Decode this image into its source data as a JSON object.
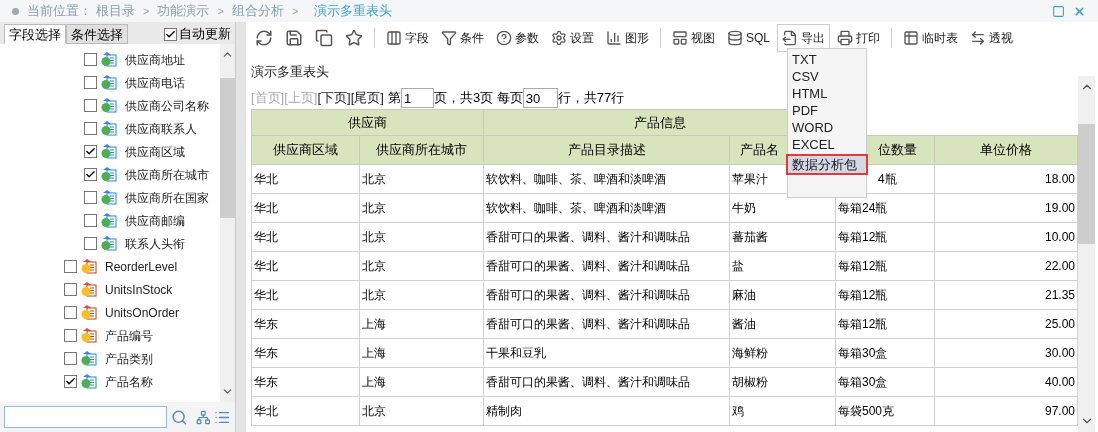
{
  "breadcrumb": {
    "label": "当前位置：",
    "items": [
      {
        "text": "根目录",
        "current": false
      },
      {
        "text": "功能演示",
        "current": false
      },
      {
        "text": "组合分析",
        "current": false
      },
      {
        "text": "演示多重表头",
        "current": true
      }
    ],
    "separator": ">"
  },
  "left_tabs": [
    {
      "label": "字段选择",
      "selected": true
    },
    {
      "label": "条件选择",
      "selected": false
    }
  ],
  "auto_update": {
    "label": "自动更新",
    "checked": true
  },
  "tree": [
    {
      "children": [
        {
          "label": "供应商地址",
          "checked": false,
          "kind": "dimension"
        },
        {
          "label": "供应商电话",
          "checked": false,
          "kind": "dimension"
        },
        {
          "label": "供应商公司名称",
          "checked": false,
          "kind": "dimension"
        },
        {
          "label": "供应商联系人",
          "checked": false,
          "kind": "dimension"
        },
        {
          "label": "供应商区域",
          "checked": true,
          "kind": "dimension"
        },
        {
          "label": "供应商所在城市",
          "checked": true,
          "kind": "dimension"
        },
        {
          "label": "供应商所在国家",
          "checked": false,
          "kind": "dimension"
        },
        {
          "label": "供应商邮编",
          "checked": false,
          "kind": "dimension"
        },
        {
          "label": "联系人头衔",
          "checked": false,
          "kind": "dimension"
        }
      ]
    },
    {
      "label": "ReorderLevel",
      "checked": false,
      "kind": "measure"
    },
    {
      "label": "UnitsInStock",
      "checked": false,
      "kind": "measure"
    },
    {
      "label": "UnitsOnOrder",
      "checked": false,
      "kind": "measure"
    },
    {
      "label": "产品编号",
      "checked": false,
      "kind": "measure"
    },
    {
      "label": "产品类别",
      "checked": false,
      "kind": "dimension"
    },
    {
      "label": "产品名称",
      "checked": true,
      "kind": "dimension"
    }
  ],
  "toolbar": [
    {
      "kind": "icon",
      "expanded": false
    },
    {
      "kind": "icon",
      "expanded": false
    },
    {
      "kind": "icon",
      "expanded": false
    },
    {
      "kind": "icon",
      "expanded": false
    },
    {
      "kind": "separator"
    },
    {
      "kind": "button",
      "label": "字段",
      "expanded": false
    },
    {
      "kind": "button",
      "label": "条件",
      "expanded": false
    },
    {
      "kind": "button",
      "label": "参数",
      "expanded": false
    },
    {
      "kind": "button",
      "label": "设置",
      "expanded": false
    },
    {
      "kind": "button",
      "label": "图形",
      "expanded": false
    },
    {
      "kind": "separator"
    },
    {
      "kind": "button",
      "label": "视图",
      "expanded": false
    },
    {
      "kind": "button",
      "label": "SQL",
      "expanded": false
    },
    {
      "kind": "button",
      "label": "导出",
      "expanded": true
    },
    {
      "kind": "button",
      "label": "打印",
      "expanded": false
    },
    {
      "kind": "separator"
    },
    {
      "kind": "button",
      "label": "临时表",
      "expanded": false
    },
    {
      "kind": "button",
      "label": "透视",
      "expanded": false
    }
  ],
  "export_menu": [
    {
      "label": "TXT",
      "selected": false
    },
    {
      "label": "CSV",
      "selected": false
    },
    {
      "label": "HTML",
      "selected": false
    },
    {
      "label": "PDF",
      "selected": false
    },
    {
      "label": "WORD",
      "selected": false
    },
    {
      "label": "EXCEL",
      "selected": false
    },
    {
      "label": "数据分析包",
      "selected": true
    }
  ],
  "report_title": "演示多重表头",
  "pager": {
    "links": [
      {
        "text": "[首页]",
        "disabled": true
      },
      {
        "text": "[上页]",
        "disabled": true
      },
      {
        "text": "[下页]",
        "disabled": false
      },
      {
        "text": "[尾页]",
        "disabled": false
      }
    ],
    "page_label": "第",
    "page": "1",
    "page_info": "页，共3页 每页",
    "page_size": "30",
    "rows_info": "行，共77行"
  },
  "table": {
    "groups": [
      {
        "label": "供应商"
      },
      {
        "label": "产品信息"
      }
    ],
    "columns": [
      "供应商区域",
      "供应商所在城市",
      "产品目录描述",
      "产品名",
      "位数量",
      "单位价格"
    ],
    "rows": [
      [
        "华北",
        "北京",
        "软饮料、咖啡、茶、啤酒和淡啤酒",
        "苹果汁",
        "4瓶",
        "18.00"
      ],
      [
        "华北",
        "北京",
        "软饮料、咖啡、茶、啤酒和淡啤酒",
        "牛奶",
        "每箱24瓶",
        "19.00"
      ],
      [
        "华北",
        "北京",
        "香甜可口的果酱、调料、酱汁和调味品",
        "蕃茄酱",
        "每箱12瓶",
        "10.00"
      ],
      [
        "华北",
        "北京",
        "香甜可口的果酱、调料、酱汁和调味品",
        "盐",
        "每箱12瓶",
        "22.00"
      ],
      [
        "华北",
        "北京",
        "香甜可口的果酱、调料、酱汁和调味品",
        "麻油",
        "每箱12瓶",
        "21.35"
      ],
      [
        "华东",
        "上海",
        "香甜可口的果酱、调料、酱汁和调味品",
        "酱油",
        "每箱12瓶",
        "25.00"
      ],
      [
        "华东",
        "上海",
        "干果和豆乳",
        "海鲜粉",
        "每箱30盒",
        "30.00"
      ],
      [
        "华东",
        "上海",
        "香甜可口的果酱、调料、酱汁和调味品",
        "胡椒粉",
        "每箱30盒",
        "40.00"
      ],
      [
        "华北",
        "北京",
        "精制肉",
        "鸡",
        "每袋500克",
        "97.00"
      ]
    ]
  }
}
